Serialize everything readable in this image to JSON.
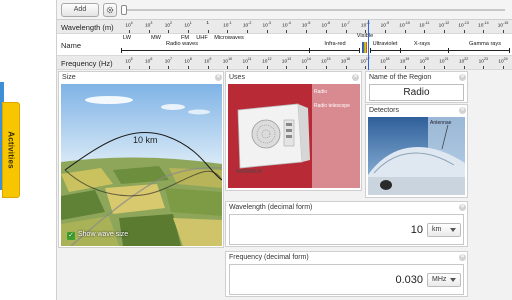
{
  "sidebar": {
    "activities_label": "Activities"
  },
  "toolbar": {
    "add_label": "Add",
    "gear_icon": "gear-icon"
  },
  "spectrum": {
    "wavelength_label": "Wavelength (m)",
    "name_label": "Name",
    "frequency_label": "Frequency (Hz)",
    "wavelength_ticks": [
      {
        "b": "10",
        "e": "4"
      },
      {
        "b": "10",
        "e": "3"
      },
      {
        "b": "10",
        "e": "2"
      },
      {
        "b": "10",
        "e": "1"
      },
      {
        "b": "1",
        "e": ""
      },
      {
        "b": "10",
        "e": "-1"
      },
      {
        "b": "10",
        "e": "-2"
      },
      {
        "b": "10",
        "e": "-3"
      },
      {
        "b": "10",
        "e": "-4"
      },
      {
        "b": "10",
        "e": "-5"
      },
      {
        "b": "10",
        "e": "-6"
      },
      {
        "b": "10",
        "e": "-7"
      },
      {
        "b": "10",
        "e": "-8"
      },
      {
        "b": "10",
        "e": "-9"
      },
      {
        "b": "10",
        "e": "-10"
      },
      {
        "b": "10",
        "e": "-11"
      },
      {
        "b": "10",
        "e": "-12"
      },
      {
        "b": "10",
        "e": "-13"
      },
      {
        "b": "10",
        "e": "-14"
      },
      {
        "b": "10",
        "e": "-15"
      }
    ],
    "frequency_ticks": [
      {
        "b": "10",
        "e": "5"
      },
      {
        "b": "10",
        "e": "6"
      },
      {
        "b": "10",
        "e": "7"
      },
      {
        "b": "10",
        "e": "8"
      },
      {
        "b": "10",
        "e": "9"
      },
      {
        "b": "10",
        "e": "10"
      },
      {
        "b": "10",
        "e": "11"
      },
      {
        "b": "10",
        "e": "12"
      },
      {
        "b": "10",
        "e": "13"
      },
      {
        "b": "10",
        "e": "14"
      },
      {
        "b": "10",
        "e": "15"
      },
      {
        "b": "10",
        "e": "16"
      },
      {
        "b": "10",
        "e": "17"
      },
      {
        "b": "10",
        "e": "18"
      },
      {
        "b": "10",
        "e": "19"
      },
      {
        "b": "10",
        "e": "20"
      },
      {
        "b": "10",
        "e": "21"
      },
      {
        "b": "10",
        "e": "22"
      },
      {
        "b": "10",
        "e": "23"
      },
      {
        "b": "10",
        "e": "24"
      }
    ],
    "sub_bands": [
      "LW",
      "MW",
      "FM",
      "UHF",
      "Microwaves",
      "Visible"
    ],
    "bands": [
      "Radio waves",
      "Infra-red",
      "Ultraviolet",
      "X-rays",
      "Gamma rays"
    ]
  },
  "size_panel": {
    "title": "Size",
    "wave_label": "10 km",
    "show_wave_label": "Show wave size",
    "show_wave_checked": true
  },
  "uses_panel": {
    "title": "Uses",
    "tags": [
      "Radio",
      "Radio telescope"
    ],
    "device_brand": "FM/MW/LW"
  },
  "region_panel": {
    "title": "Name of the Region",
    "value": "Radio"
  },
  "detectors_panel": {
    "title": "Detectors",
    "tag": "Antennae"
  },
  "wavelength_panel": {
    "title": "Wavelength (decimal form)",
    "value": "10",
    "unit": "km"
  },
  "frequency_panel": {
    "title": "Frequency (decimal form)",
    "value": "0.030",
    "unit": "MHz"
  },
  "colors": {
    "accent_blue": "#2f63d6",
    "activities_yellow": "#f7c600",
    "radio_red": "#c23a4a"
  }
}
